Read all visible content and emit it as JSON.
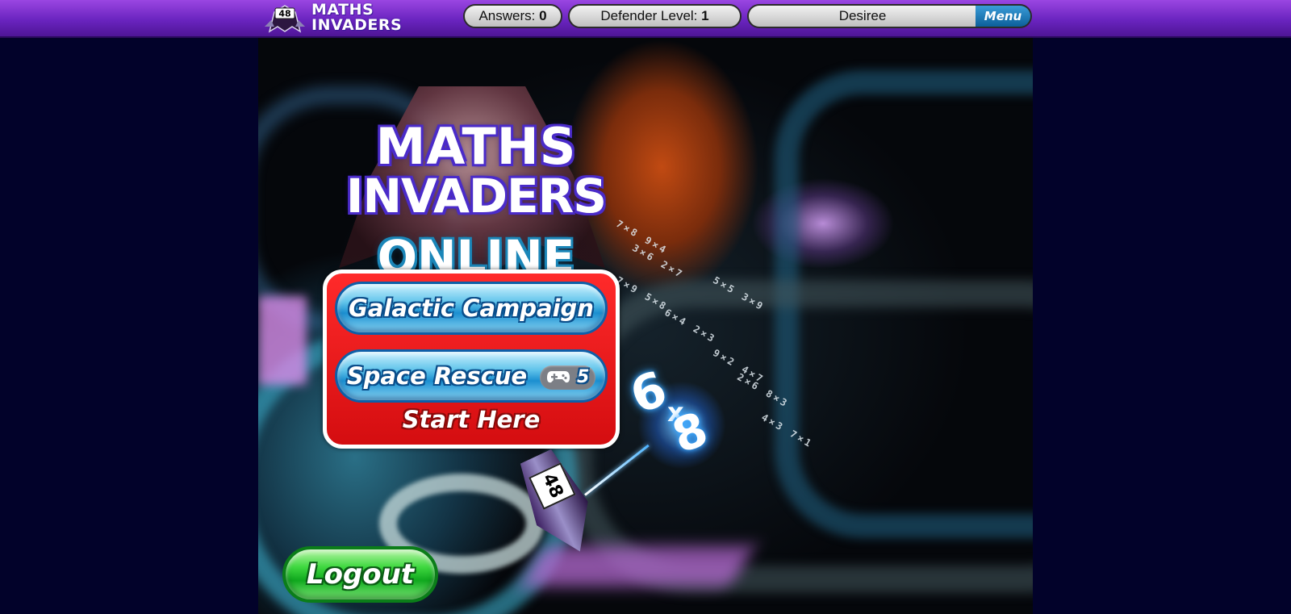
{
  "header": {
    "logo": {
      "badge_number": "48",
      "line1": "MATHS",
      "line2": "INVADERS"
    },
    "answers": {
      "label": "Answers:",
      "value": "0"
    },
    "defender": {
      "label": "Defender Level:",
      "value": "1"
    },
    "username": "Desiree",
    "menu_label": "Menu"
  },
  "title": {
    "line1": "MATHS",
    "line2": "INVADERS",
    "line3": "ONLINE"
  },
  "menu": {
    "galactic_campaign": "Galactic Campaign",
    "space_rescue": "Space Rescue",
    "space_rescue_badge_icon": "gamepad-icon",
    "space_rescue_badge_count": "5",
    "start_here": "Start Here"
  },
  "scene": {
    "multiplier_a": "6",
    "multiplier_op": "x",
    "multiplier_b": "8",
    "ship_number": "48"
  },
  "logout_label": "Logout",
  "colors": {
    "topbar": "#6a24bf",
    "page_bg": "#02022a",
    "panel": "#e81818",
    "blue_button": "#1b8fd0",
    "green_button": "#10a81e"
  }
}
